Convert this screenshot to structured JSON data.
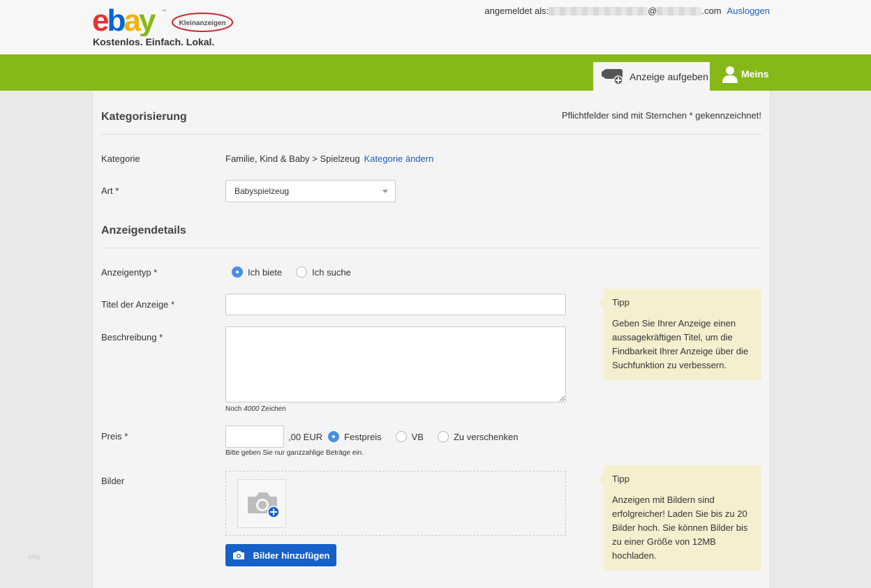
{
  "header": {
    "brand": "ebay",
    "brand_sub": "Kleinanzeigen",
    "tagline": "Kostenlos. Einfach. Lokal.",
    "logged_in_prefix": "angemeldet als:",
    "email_at": "@",
    "email_suffix": ".com",
    "logout": "Ausloggen"
  },
  "nav": {
    "post_ad": "Anzeige aufgeben",
    "mine": "Meins"
  },
  "side_note": "blog",
  "form": {
    "required_note": "Pflichtfelder sind mit Sternchen * gekennzeichnet!",
    "section_categorization": "Kategorisierung",
    "category_label": "Kategorie",
    "category_value": "Familie, Kind & Baby > Spielzeug",
    "category_change": "Kategorie ändern",
    "type_label": "Art *",
    "type_value": "Babyspielzeug",
    "section_details": "Anzeigendetails",
    "adtype_label": "Anzeigentyp *",
    "adtype_options": [
      {
        "label": "Ich biete",
        "selected": true
      },
      {
        "label": "Ich suche",
        "selected": false
      }
    ],
    "title_label": "Titel der Anzeige *",
    "title_value": "",
    "description_label": "Beschreibung *",
    "description_value": "",
    "chars_left_prefix": "Noch",
    "chars_left_count": "4000",
    "chars_left_suffix": "Zeichen",
    "price_label": "Preis *",
    "price_value": "",
    "price_suffix": ",00 EUR",
    "price_options": [
      {
        "label": "Festpreis",
        "selected": true
      },
      {
        "label": "VB",
        "selected": false
      },
      {
        "label": "Zu verschenken",
        "selected": false
      }
    ],
    "price_hint": "Bitte geben Sie nur ganzzahlige Beträge ein.",
    "images_label": "Bilder",
    "add_images": "Bilder hinzufügen"
  },
  "tips": [
    {
      "title": "Tipp",
      "text": "Geben Sie Ihrer Anzeige einen aussagekräftigen Titel, um die Findbarkeit Ihrer Anzeige über die Suchfunktion zu verbessern."
    },
    {
      "title": "Tipp",
      "text": "Anzeigen mit Bildern sind erfolgreicher! Laden Sie bis zu 20 Bilder hoch. Sie können Bilder bis zu einer Größe von 12MB hochladen."
    }
  ],
  "colors": {
    "green": "#86b817",
    "link": "#1d5fb5",
    "button": "#1760c8",
    "radio_on": "#4a90e2",
    "tip_bg": "#f5efd0"
  }
}
